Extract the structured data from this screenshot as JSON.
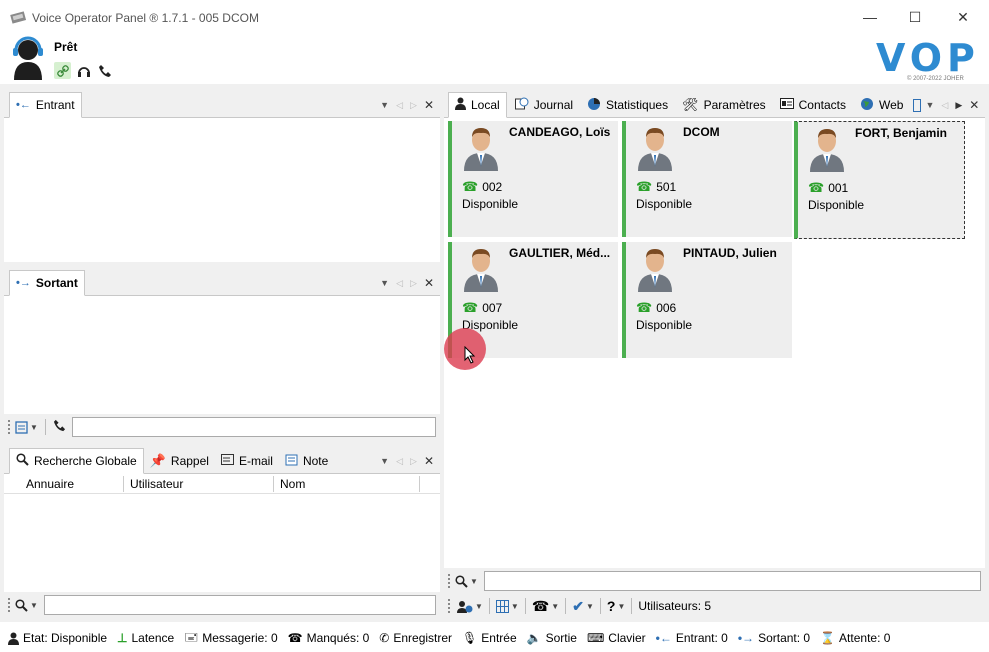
{
  "window": {
    "title": "Voice Operator Panel ® 1.7.1 - 005 DCOM",
    "minimize": "—",
    "maximize": "☐",
    "close": "✕"
  },
  "agent": {
    "status": "Prêt"
  },
  "brand": {
    "logo": "VOP",
    "copyright": "© 2007-2022 JOHER",
    "accent": "#2e8bd1"
  },
  "entrant": {
    "tab": "Entrant"
  },
  "sortant": {
    "tab": "Sortant"
  },
  "search": {
    "tabs": [
      "Recherche Globale",
      "Rappel",
      "E-mail",
      "Note"
    ],
    "columns": [
      "Annuaire",
      "Utilisateur",
      "Nom"
    ]
  },
  "main": {
    "tabs": [
      "Local",
      "Journal",
      "Statistiques",
      "Paramètres",
      "Contacts",
      "Web"
    ],
    "contacts": [
      {
        "name": "CANDEAGO, Loïs",
        "ext": "002",
        "status": "Disponible"
      },
      {
        "name": "DCOM",
        "ext": "501",
        "status": "Disponible"
      },
      {
        "name": "FORT, Benjamin",
        "ext": "001",
        "status": "Disponible"
      },
      {
        "name": "GAULTIER, Méd...",
        "ext": "007",
        "status": "Disponible"
      },
      {
        "name": "PINTAUD, Julien",
        "ext": "006",
        "status": "Disponible"
      }
    ],
    "users_count": "Utilisateurs: 5",
    "available_color": "#4caf50"
  },
  "statusbar": {
    "etat": "Etat: Disponible",
    "latence": "Latence",
    "messagerie": "Messagerie: 0",
    "manques": "Manqués: 0",
    "enregistrer": "Enregistrer",
    "entree": "Entrée",
    "sortie": "Sortie",
    "clavier": "Clavier",
    "entrant": "Entrant: 0",
    "sortant": "Sortant: 0",
    "attente": "Attente: 0"
  }
}
